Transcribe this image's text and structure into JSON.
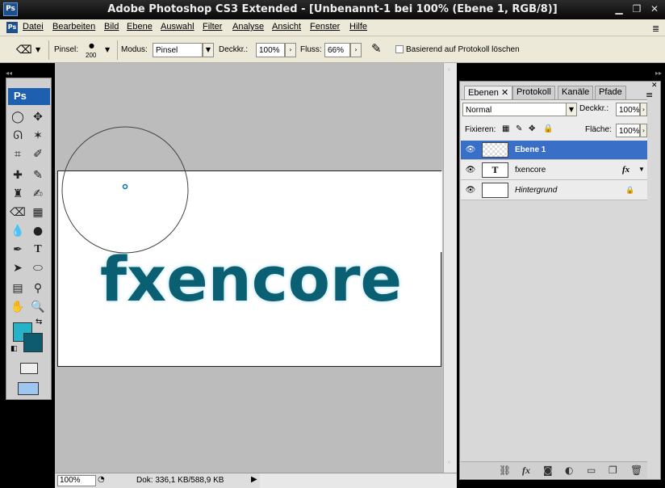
{
  "window": {
    "title": "Adobe Photoshop CS3 Extended - [Unbenannt-1 bei 100% (Ebene 1, RGB/8)]",
    "app_badge": "Ps"
  },
  "menu": [
    "Datei",
    "Bearbeiten",
    "Bild",
    "Ebene",
    "Auswahl",
    "Filter",
    "Analyse",
    "Ansicht",
    "Fenster",
    "Hilfe"
  ],
  "options": {
    "brush_label": "Pinsel:",
    "brush_size": "200",
    "mode_label": "Modus:",
    "mode_value": "Pinsel",
    "opacity_label": "Deckkr.:",
    "opacity_value": "100%",
    "flow_label": "Fluss:",
    "flow_value": "66%",
    "erase_history_label": "Basierend auf Protokoll löschen"
  },
  "toolbox": {
    "badge": "Ps",
    "foreground": "#26b3c8",
    "background": "#0e5a6e"
  },
  "canvas": {
    "logo_text": "fxencore",
    "logo_light": "#30b8cf",
    "logo_dark": "#0b5f72"
  },
  "status": {
    "zoom": "100%",
    "doc_info": "Dok: 336,1 KB/588,9 KB"
  },
  "layers_panel": {
    "tabs": [
      "Ebenen",
      "Protokoll",
      "Kanäle",
      "Pfade"
    ],
    "blend_mode": "Normal",
    "opacity_label": "Deckkr.:",
    "opacity_value": "100%",
    "lock_label": "Fixieren:",
    "fill_label": "Fläche:",
    "fill_value": "100%",
    "layers": [
      {
        "name": "Ebene 1",
        "selected": true,
        "thumb": "",
        "fx": ""
      },
      {
        "name": "fxencore",
        "selected": false,
        "thumb": "T",
        "fx": "fx"
      },
      {
        "name": "Hintergrund",
        "selected": false,
        "thumb": "",
        "fx": ""
      }
    ]
  }
}
